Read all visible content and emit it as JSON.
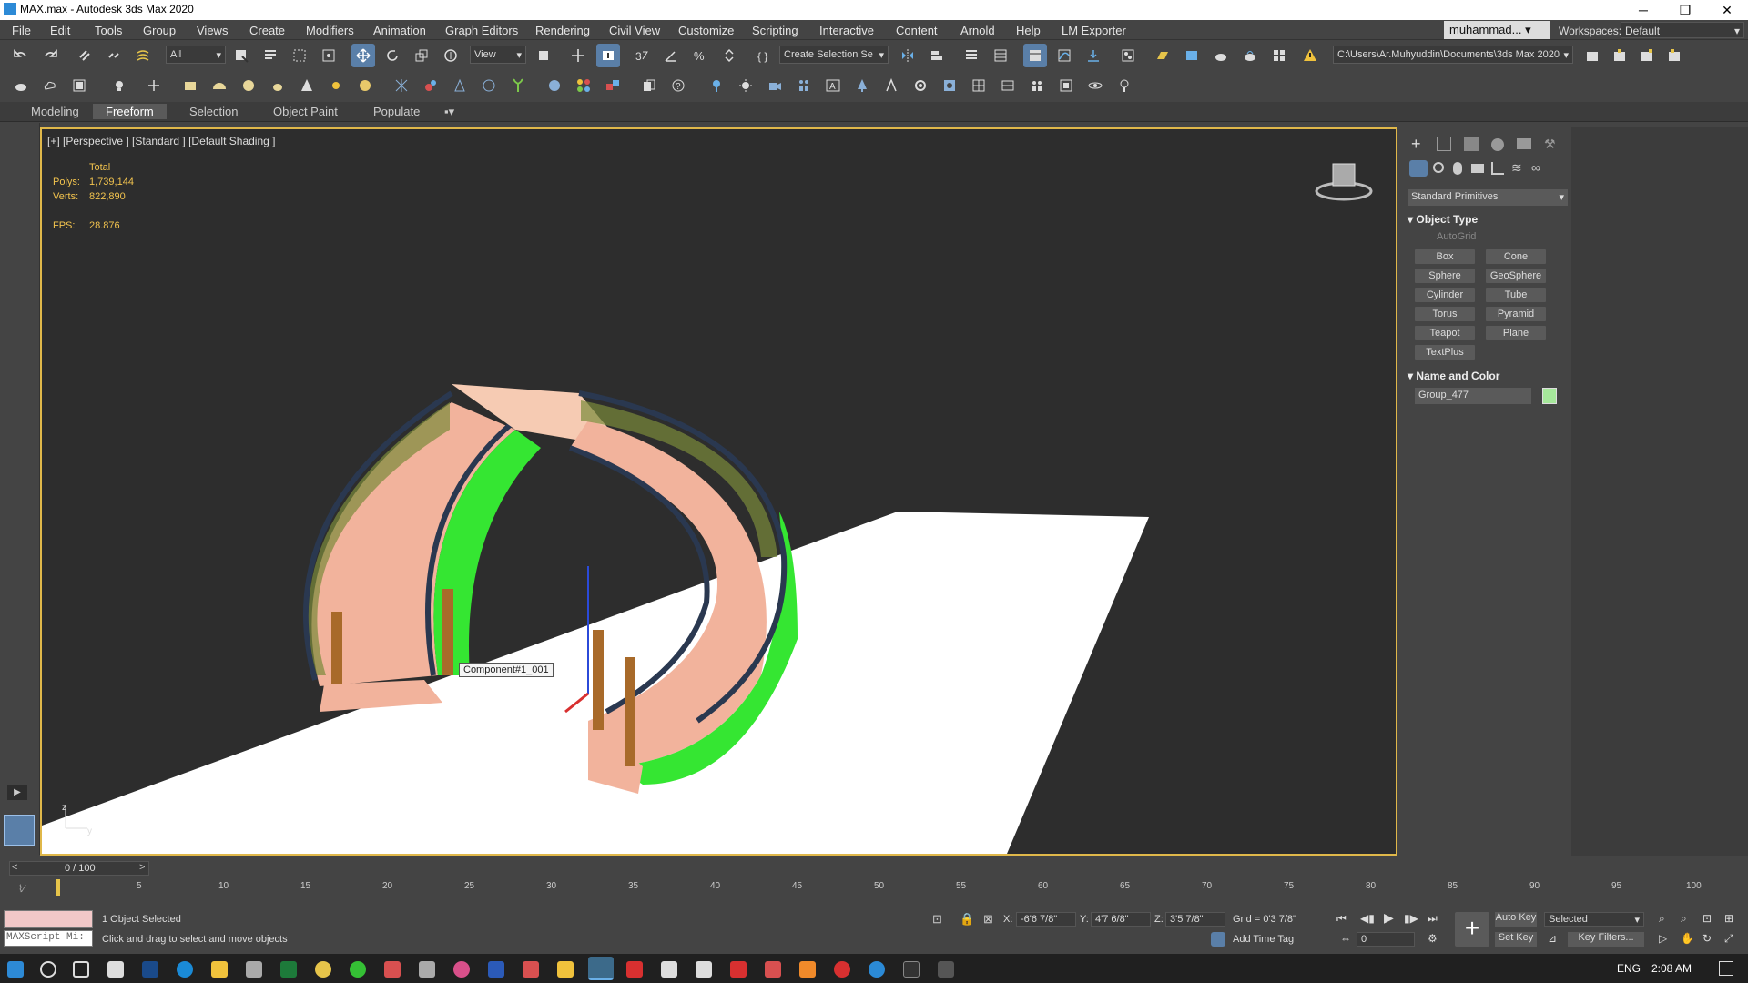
{
  "window": {
    "title": "MAX.max - Autodesk 3ds Max 2020"
  },
  "menu": [
    "File",
    "Edit",
    "Tools",
    "Group",
    "Views",
    "Create",
    "Modifiers",
    "Animation",
    "Graph Editors",
    "Rendering",
    "Civil View",
    "Customize",
    "Scripting",
    "Interactive",
    "Content",
    "Arnold",
    "Help",
    "LM Exporter"
  ],
  "user": {
    "name": "muhammad..."
  },
  "workspace": {
    "label": "Workspaces:",
    "value": "Default"
  },
  "toolbar": {
    "selection_filter": "All",
    "ref_coord": "View",
    "named_selection": "Create Selection Se",
    "project_path": "C:\\Users\\Ar.Muhyuddin\\Documents\\3ds Max 2020"
  },
  "ribbon_tabs": [
    "Modeling",
    "Freeform",
    "Selection",
    "Object Paint",
    "Populate"
  ],
  "ribbon_active": "Freeform",
  "viewport": {
    "label": "[+] [Perspective ] [Standard ] [Default Shading ]",
    "stats_title": "Total",
    "polys_label": "Polys:",
    "polys": "1,739,144",
    "verts_label": "Verts:",
    "verts": "822,890",
    "fps_label": "FPS:",
    "fps": "28.876",
    "tooltip": "Component#1_001",
    "axis_x": "x",
    "axis_y": "y",
    "axis_z": "z"
  },
  "command_panel": {
    "category": "Standard Primitives",
    "object_type_title": "Object Type",
    "autogrid": "AutoGrid",
    "primitives": [
      "Box",
      "Cone",
      "Sphere",
      "GeoSphere",
      "Cylinder",
      "Tube",
      "Torus",
      "Pyramid",
      "Teapot",
      "Plane",
      "TextPlus"
    ],
    "name_color_title": "Name and Color",
    "object_name": "Group_477",
    "object_color": "#a6e89b"
  },
  "timeline": {
    "frame_display": "0 / 100",
    "ticks": [
      "5",
      "10",
      "15",
      "20",
      "25",
      "30",
      "35",
      "40",
      "45",
      "50",
      "55",
      "60",
      "65",
      "70",
      "75",
      "80",
      "85",
      "90",
      "95",
      "100"
    ]
  },
  "status": {
    "maxscript": "MAXScript Mi:",
    "selected": "1 Object Selected",
    "hint": "Click and drag to select and move objects",
    "x_label": "X:",
    "x": "-6'6 7/8\"",
    "y_label": "Y:",
    "y": "4'7 6/8\"",
    "z_label": "Z:",
    "z": "3'5 7/8\"",
    "grid": "Grid = 0'3 7/8\"",
    "add_time_tag": "Add Time Tag",
    "auto_key": "Auto Key",
    "set_key": "Set Key",
    "selected_dropdown": "Selected",
    "key_filters": "Key Filters...",
    "frame": "0"
  },
  "taskbar": {
    "lang": "ENG",
    "time": "2:08 AM"
  }
}
